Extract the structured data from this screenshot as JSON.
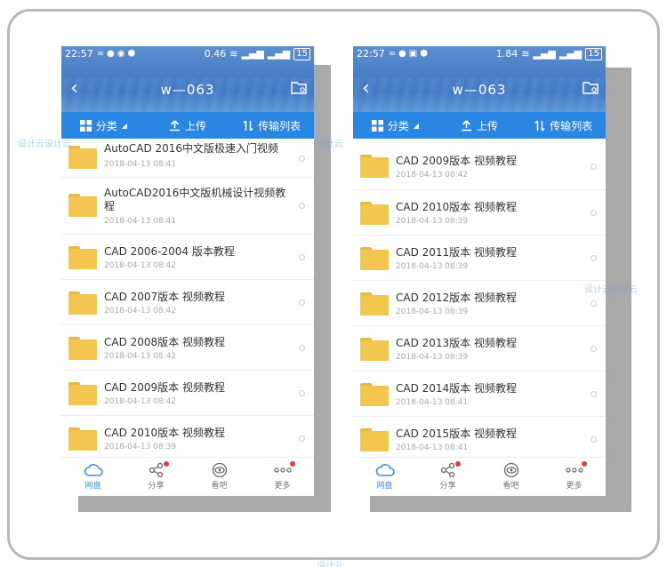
{
  "colors": {
    "toolbar": "#2a86e3",
    "accent": "#3a8ee6",
    "badge": "#e83b3b",
    "folder": "#f2c64f"
  },
  "left": {
    "status": {
      "time": "22:57",
      "speed": "0.46",
      "speed_unit": "k/s",
      "battery": "15"
    },
    "title": "w—063",
    "toolbar": {
      "category": "分类",
      "upload": "上传",
      "transfer": "传输列表"
    },
    "files": [
      {
        "name": "AutoCAD 2016中文版极速入门视频",
        "date": "2018-04-13  08:41"
      },
      {
        "name": "AutoCAD2016中文版机械设计视频教程",
        "date": "2018-04-13  08:41"
      },
      {
        "name": "CAD 2006-2004 版本教程",
        "date": "2018-04-13  08:42"
      },
      {
        "name": "CAD 2007版本 视频教程",
        "date": "2018-04-13  08:42"
      },
      {
        "name": "CAD 2008版本  视频教程",
        "date": "2018-04-13  08:42"
      },
      {
        "name": "CAD 2009版本  视频教程",
        "date": "2018-04-13  08:42"
      },
      {
        "name": "CAD 2010版本  视频教程",
        "date": "2018-04-13  08:39"
      }
    ],
    "nav": {
      "disk": "网盘",
      "share": "分享",
      "watch": "看吧",
      "more": "更多"
    }
  },
  "right": {
    "status": {
      "time": "22:57",
      "speed": "1.84",
      "speed_unit": "k/s",
      "battery": "15"
    },
    "title": "w—063",
    "toolbar": {
      "category": "分类",
      "upload": "上传",
      "transfer": "传输列表"
    },
    "files": [
      {
        "name": "CAD 2009版本  视频教程",
        "date": "2018-04-13  08:42"
      },
      {
        "name": "CAD 2010版本  视频教程",
        "date": "2018-04-13  08:39"
      },
      {
        "name": "CAD 2011版本  视频教程",
        "date": "2018-04-13  08:39"
      },
      {
        "name": "CAD 2012版本  视频教程",
        "date": "2018-04-13  08:39"
      },
      {
        "name": "CAD 2013版本  视频教程",
        "date": "2018-04-13  08:39"
      },
      {
        "name": "CAD 2014版本 视频教程",
        "date": "2018-04-13  08:41"
      },
      {
        "name": "CAD 2015版本 视频教程",
        "date": "2018-04-13  08:41"
      }
    ],
    "nav": {
      "disk": "网盘",
      "share": "分享",
      "watch": "看吧",
      "more": "更多"
    }
  },
  "watermarks": [
    "设计云设计云",
    "设计云",
    "设计云设计云",
    "设计云"
  ]
}
